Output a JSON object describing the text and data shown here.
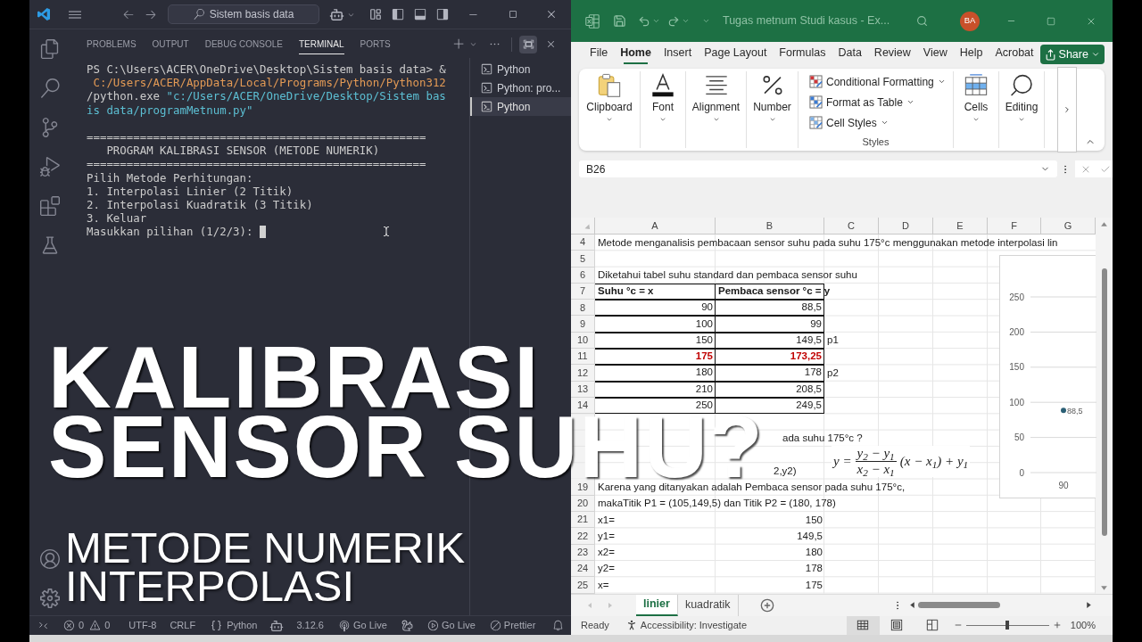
{
  "vscode": {
    "search": "Sistem basis data",
    "panel_tabs": [
      {
        "label": "PROBLEMS",
        "selected": false
      },
      {
        "label": "OUTPUT",
        "selected": false
      },
      {
        "label": "DEBUG CONSOLE",
        "selected": false
      },
      {
        "label": "TERMINAL",
        "selected": true
      },
      {
        "label": "PORTS",
        "selected": false
      }
    ],
    "terminal": {
      "lines": [
        {
          "segments": [
            {
              "text": "PS C:\\Users\\ACER\\OneDrive\\Desktop\\Sistem basis data> &",
              "kind": "plain"
            }
          ]
        },
        {
          "segments": [
            {
              "text": " C:/Users/ACER/AppData/Local/Programs/Python/Python312",
              "kind": "path"
            }
          ]
        },
        {
          "segments": [
            {
              "text": "/python.exe",
              "kind": "plain"
            },
            {
              "text": " \"c:/Users/ACER/OneDrive/Desktop/Sistem bas",
              "kind": "string"
            }
          ]
        },
        {
          "segments": [
            {
              "text": "is data/programMetnum.py\"",
              "kind": "string"
            }
          ]
        },
        {
          "segments": [
            {
              "text": "===================================================",
              "kind": "plain"
            }
          ],
          "blank_before": true
        },
        {
          "segments": [
            {
              "text": "   PROGRAM KALIBRASI SENSOR (METODE NUMERIK)",
              "kind": "plain"
            }
          ]
        },
        {
          "segments": [
            {
              "text": "===================================================",
              "kind": "plain"
            }
          ]
        },
        {
          "segments": [
            {
              "text": "Pilih Metode Perhitungan:",
              "kind": "plain"
            }
          ]
        },
        {
          "segments": [
            {
              "text": "1. Interpolasi Linier (2 Titik)",
              "kind": "plain"
            }
          ]
        },
        {
          "segments": [
            {
              "text": "2. Interpolasi Kuadratik (3 Titik)",
              "kind": "plain"
            }
          ]
        },
        {
          "segments": [
            {
              "text": "3. Keluar",
              "kind": "plain"
            }
          ]
        },
        {
          "segments": [
            {
              "text": "Masukkan pilihan (1/2/3):",
              "kind": "plain"
            }
          ],
          "cursor": true
        }
      ]
    },
    "terminal_list": [
      {
        "label": "Python",
        "selected": false
      },
      {
        "label": "Python: pro...",
        "selected": false
      },
      {
        "label": "Python",
        "selected": true
      }
    ],
    "status_bar": {
      "errors": "0",
      "warnings": "0",
      "encoding": "UTF-8",
      "line_ending": "CRLF",
      "language": "Python",
      "interpreter": "3.12.6",
      "items": [
        {
          "label": "Go Live",
          "kind": "broadcast"
        },
        {
          "label": "Go Live",
          "kind": "play"
        },
        {
          "label": "Prettier",
          "kind": "ban"
        }
      ]
    }
  },
  "excel": {
    "title": "Tugas metnum Studi kasus - Ex...",
    "avatar": "BA",
    "menu_tabs": [
      {
        "label": "File",
        "selected": false
      },
      {
        "label": "Home",
        "selected": true
      },
      {
        "label": "Insert",
        "selected": false
      },
      {
        "label": "Page Layout",
        "selected": false
      },
      {
        "label": "Formulas",
        "selected": false
      },
      {
        "label": "Data",
        "selected": false
      },
      {
        "label": "Review",
        "selected": false
      },
      {
        "label": "View",
        "selected": false
      },
      {
        "label": "Help",
        "selected": false
      },
      {
        "label": "Acrobat",
        "selected": false
      }
    ],
    "share": "Share",
    "ribbon": {
      "groups": [
        {
          "label": "Clipboard",
          "kind": "clipboard"
        },
        {
          "label": "Font",
          "kind": "font"
        },
        {
          "label": "Alignment",
          "kind": "alignment"
        },
        {
          "label": "Number",
          "kind": "number"
        },
        {
          "label": "Styles",
          "kind": "styles",
          "items": [
            {
              "label": "Conditional Formatting",
              "kind": "conditional"
            },
            {
              "label": "Format as Table",
              "kind": "table"
            },
            {
              "label": "Cell Styles",
              "kind": "cellstyles"
            }
          ]
        },
        {
          "label": "Cells",
          "kind": "cells"
        },
        {
          "label": "Editing",
          "kind": "editing"
        }
      ]
    },
    "name_box": "B26",
    "columns": [
      "A",
      "B",
      "C",
      "D",
      "E",
      "F",
      "G"
    ],
    "rows": [
      {
        "number": "4",
        "kind": "plain",
        "cells": [
          {
            "text": "Metode menganalisis pembacaan sensor suhu pada suhu 175°c menggunakan metode interpolasi lin",
            "kind": "text"
          }
        ]
      },
      {
        "number": "5",
        "kind": "plain"
      },
      {
        "number": "6",
        "kind": "plain",
        "cells": [
          {
            "text": "Diketahui tabel suhu standard dan pembaca sensor suhu",
            "kind": "text"
          }
        ]
      },
      {
        "number": "7",
        "kind": "table_header",
        "cells": [
          {
            "text": "Suhu °c = x",
            "kind": "text"
          },
          {
            "text": "Pembaca sensor °c = y",
            "kind": "text"
          }
        ]
      },
      {
        "number": "8",
        "kind": "table",
        "cells": [
          {
            "text": "90",
            "kind": "number",
            "highlight": false
          },
          {
            "text": "88,5",
            "kind": "number",
            "highlight": false
          }
        ]
      },
      {
        "number": "9",
        "kind": "table",
        "cells": [
          {
            "text": "100",
            "kind": "number",
            "highlight": false
          },
          {
            "text": "99",
            "kind": "number",
            "highlight": false
          }
        ]
      },
      {
        "number": "10",
        "kind": "table",
        "cells": [
          {
            "text": "150",
            "kind": "number",
            "highlight": false
          },
          {
            "text": "149,5",
            "kind": "number",
            "highlight": false
          },
          {
            "text": "p1",
            "kind": "text",
            "highlight": false
          }
        ]
      },
      {
        "number": "11",
        "kind": "table",
        "cells": [
          {
            "text": "175",
            "kind": "number",
            "highlight": true
          },
          {
            "text": "173,25",
            "kind": "number",
            "highlight": true
          }
        ]
      },
      {
        "number": "12",
        "kind": "table",
        "cells": [
          {
            "text": "180",
            "kind": "number",
            "highlight": false
          },
          {
            "text": "178",
            "kind": "number",
            "highlight": false
          },
          {
            "text": "p2",
            "kind": "text",
            "highlight": false
          }
        ]
      },
      {
        "number": "13",
        "kind": "table",
        "cells": [
          {
            "text": "210",
            "kind": "number",
            "highlight": false
          },
          {
            "text": "208,5",
            "kind": "number",
            "highlight": false
          }
        ]
      },
      {
        "number": "14",
        "kind": "table",
        "cells": [
          {
            "text": "250",
            "kind": "number",
            "highlight": false
          },
          {
            "text": "249,5",
            "kind": "number",
            "highlight": false
          }
        ]
      },
      {
        "kind": "covered"
      },
      {
        "kind": "covered",
        "cells": [
          {},
          {
            "text": "ada suhu 175°c ?",
            "kind": "text"
          }
        ]
      },
      {
        "kind": "covered"
      },
      {
        "kind": "covered",
        "cells": [
          {},
          {
            "text": "2,y2)",
            "kind": "text"
          }
        ]
      },
      {
        "number": "19",
        "kind": "plain",
        "cells": [
          {
            "text": "Karena yang ditanyakan adalah Pembaca sensor pada suhu 175°c,",
            "kind": "text"
          }
        ]
      },
      {
        "number": "20",
        "kind": "plain",
        "cells": [
          {
            "text": "makaTitik P1 = (105,149,5) dan Titik P2 = (180, 178)",
            "kind": "text"
          }
        ]
      },
      {
        "number": "21",
        "kind": "plain",
        "cells": [
          {
            "text": "x1=",
            "kind": "text"
          },
          {
            "text": "150",
            "kind": "number"
          }
        ]
      },
      {
        "number": "22",
        "kind": "plain",
        "cells": [
          {
            "text": "y1=",
            "kind": "text"
          },
          {
            "text": "149,5",
            "kind": "number"
          }
        ]
      },
      {
        "number": "23",
        "kind": "plain",
        "cells": [
          {
            "text": "x2=",
            "kind": "text"
          },
          {
            "text": "180",
            "kind": "number"
          }
        ]
      },
      {
        "number": "24",
        "kind": "plain",
        "cells": [
          {
            "text": "y2=",
            "kind": "text"
          },
          {
            "text": "178",
            "kind": "number"
          }
        ]
      },
      {
        "number": "25",
        "kind": "plain",
        "cells": [
          {
            "text": "x=",
            "kind": "text"
          },
          {
            "text": "175",
            "kind": "number"
          }
        ]
      }
    ],
    "formula": {
      "lhs": "y =",
      "numerator": "y$_{2}$ − y$_{1}$",
      "denominator": "x$_{2}$ − x$_{1}$",
      "rhs": "(x − x$_{1}$) + y$_{1}$"
    },
    "chart": {
      "chart_data": [
        {
          "type": "line",
          "categories": [
            "90"
          ],
          "values": [
            88.5
          ],
          "yticks": [
            0,
            50,
            100,
            150,
            200,
            250
          ],
          "ylim": [
            0,
            250
          ],
          "value_labels": [
            "88,5"
          ],
          "color": "#2b5f75",
          "marker": "circle",
          "grid": true
        }
      ]
    },
    "sheet_tabs": [
      {
        "label": "linier",
        "selected": true
      },
      {
        "label": "kuadratik",
        "selected": false
      }
    ],
    "status_bar": {
      "mode": "Ready",
      "accessibility": "Accessibility: Investigate",
      "views": [
        {
          "kind": "normal",
          "selected": true
        },
        {
          "kind": "page_layout",
          "selected": false
        },
        {
          "kind": "page_break",
          "selected": false
        }
      ],
      "zoom": {
        "level": 0.5
      },
      "zoom_reading": "100%"
    }
  },
  "overlay": {
    "title_lines": [
      "KALIBRASI",
      "SENSOR SUHU?"
    ],
    "subtitle_lines": [
      "METODE NUMERIK",
      "INTERPOLASI"
    ]
  }
}
